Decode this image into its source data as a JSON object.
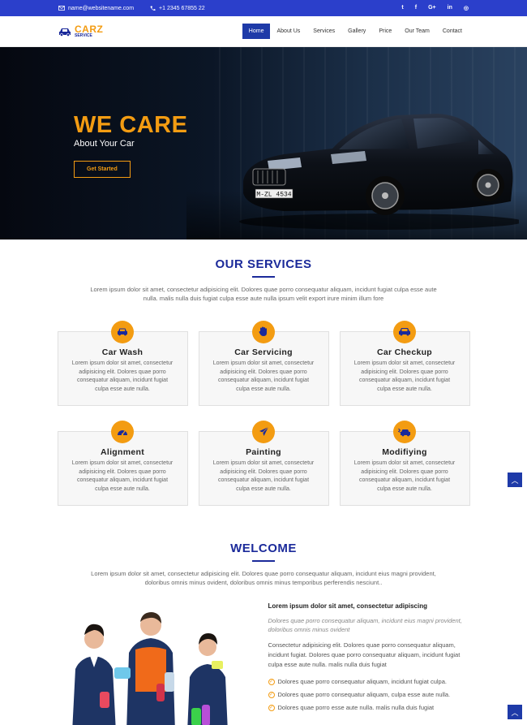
{
  "topbar": {
    "email": "name@websitename.com",
    "phone": "+1 2345 67855 22",
    "social": [
      "twitter",
      "facebook",
      "google-plus",
      "linkedin",
      "instagram"
    ],
    "social_labels": [
      "t",
      "f",
      "G+",
      "in",
      "◎"
    ]
  },
  "logo": {
    "name": "CARZ",
    "tagline": "SERVICE"
  },
  "nav": {
    "items": [
      "Home",
      "About Us",
      "Services",
      "Gallery",
      "Price",
      "Our Team",
      "Contact"
    ],
    "active": "Home"
  },
  "hero": {
    "title": "WE CARE",
    "subtitle": "About Your Car",
    "button": "Get Started",
    "plate": "M-ZL 4534"
  },
  "services": {
    "title": "OUR SERVICES",
    "intro": "Lorem ipsum dolor sit amet, consectetur adipisicing elit. Dolores quae porro consequatur aliquam, incidunt fugiat culpa esse aute nulla. malis nulla duis fugiat culpa esse aute nulla ipsum velit export irure minim illum fore",
    "items": [
      {
        "title": "Car Wash",
        "icon": "car-icon",
        "text": "Lorem ipsum dolor sit amet, consectetur adipisicing elit. Dolores quae porro consequatur aliquam, incidunt fugiat culpa esse aute nulla."
      },
      {
        "title": "Car Servicing",
        "icon": "hand-icon",
        "text": "Lorem ipsum dolor sit amet, consectetur adipisicing elit. Dolores quae porro consequatur aliquam, incidunt fugiat culpa esse aute nulla."
      },
      {
        "title": "Car Checkup",
        "icon": "car-icon",
        "text": "Lorem ipsum dolor sit amet, consectetur adipisicing elit. Dolores quae porro consequatur aliquam, incidunt fugiat culpa esse aute nulla."
      },
      {
        "title": "Alignment",
        "icon": "gauge-icon",
        "text": "Lorem ipsum dolor sit amet, consectetur adipisicing elit. Dolores quae porro consequatur aliquam, incidunt fugiat culpa esse aute nulla."
      },
      {
        "title": "Painting",
        "icon": "paper-plane-icon",
        "text": "Lorem ipsum dolor sit amet, consectetur adipisicing elit. Dolores quae porro consequatur aliquam, incidunt fugiat culpa esse aute nulla."
      },
      {
        "title": "Modifiying",
        "icon": "car-crash-icon",
        "text": "Lorem ipsum dolor sit amet, consectetur adipisicing elit. Dolores quae porro consequatur aliquam, incidunt fugiat culpa esse aute nulla."
      }
    ]
  },
  "welcome": {
    "title": "WELCOME",
    "intro": "Lorem ipsum dolor sit amet, consectetur adipisicing elit. Dolores quae porro consequatur aliquam, incidunt eius magni provident, doloribus omnis minus ovident, doloribus omnis minus temporibus perferendis nesciunt..",
    "heading": "Lorem ipsum dolor sit amet, consectetur adipiscing",
    "italic": "Dolores quae porro consequatur aliquam, incidunt eius magni provident, doloribus omnis minus ovident",
    "para": "Consectetur adipisicing elit. Dolores quae porro consequatur aliquam, incidunt fugiat. Dolores quae porro consequatur aliquam, incidunt fugiat culpa esse aute nulla. malis nulla duis fugiat",
    "list": [
      "Dolores quae porro consequatur aliquam, incidunt fugiat culpa.",
      "Dolores quae porro consequatur aliquam, culpa esse aute nulla.",
      "Dolores quae porro esse aute nulla. malis nulla duis fugiat"
    ]
  },
  "colors": {
    "accent": "#f39c12",
    "primary": "#1b2a9a",
    "topbar": "#2b3fcb"
  }
}
